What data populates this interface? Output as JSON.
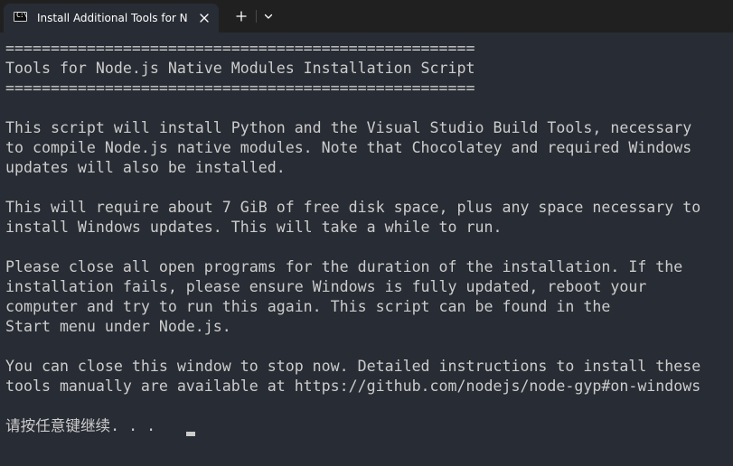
{
  "window": {
    "tab_title": "Install Additional Tools for Nc",
    "tab_icon": "terminal-cmd-icon",
    "close_icon": "close-icon",
    "new_tab_icon": "plus-icon",
    "dropdown_icon": "chevron-down-icon"
  },
  "terminal": {
    "lines": [
      "====================================================",
      "Tools for Node.js Native Modules Installation Script",
      "====================================================",
      "",
      "This script will install Python and the Visual Studio Build Tools, necessary",
      "to compile Node.js native modules. Note that Chocolatey and required Windows",
      "updates will also be installed.",
      "",
      "This will require about 7 GiB of free disk space, plus any space necessary to",
      "install Windows updates. This will take a while to run.",
      "",
      "Please close all open programs for the duration of the installation. If the",
      "installation fails, please ensure Windows is fully updated, reboot your",
      "computer and try to run this again. This script can be found in the",
      "Start menu under Node.js.",
      "",
      "You can close this window to stop now. Detailed instructions to install these",
      "tools manually are available at https://github.com/nodejs/node-gyp#on-windows",
      "",
      "请按任意键继续. . . "
    ]
  },
  "colors": {
    "titlebar_bg": "#202020",
    "terminal_bg": "#282c34",
    "text": "#cccccc"
  }
}
